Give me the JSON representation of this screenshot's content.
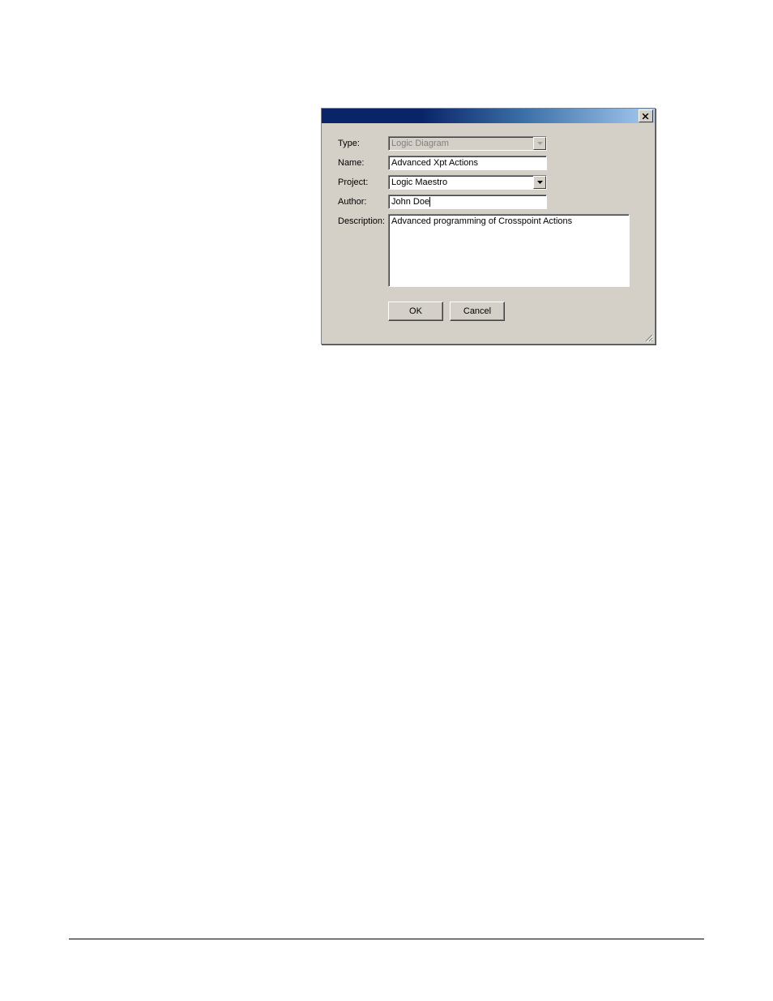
{
  "dialog": {
    "labels": {
      "type": "Type:",
      "name": "Name:",
      "project": "Project:",
      "author": "Author:",
      "description": "Description:"
    },
    "values": {
      "type": "Logic Diagram",
      "name": "Advanced Xpt Actions",
      "project": "Logic Maestro",
      "author": "John Doe",
      "description": "Advanced programming of Crosspoint Actions"
    },
    "buttons": {
      "ok": "OK",
      "cancel": "Cancel"
    }
  }
}
